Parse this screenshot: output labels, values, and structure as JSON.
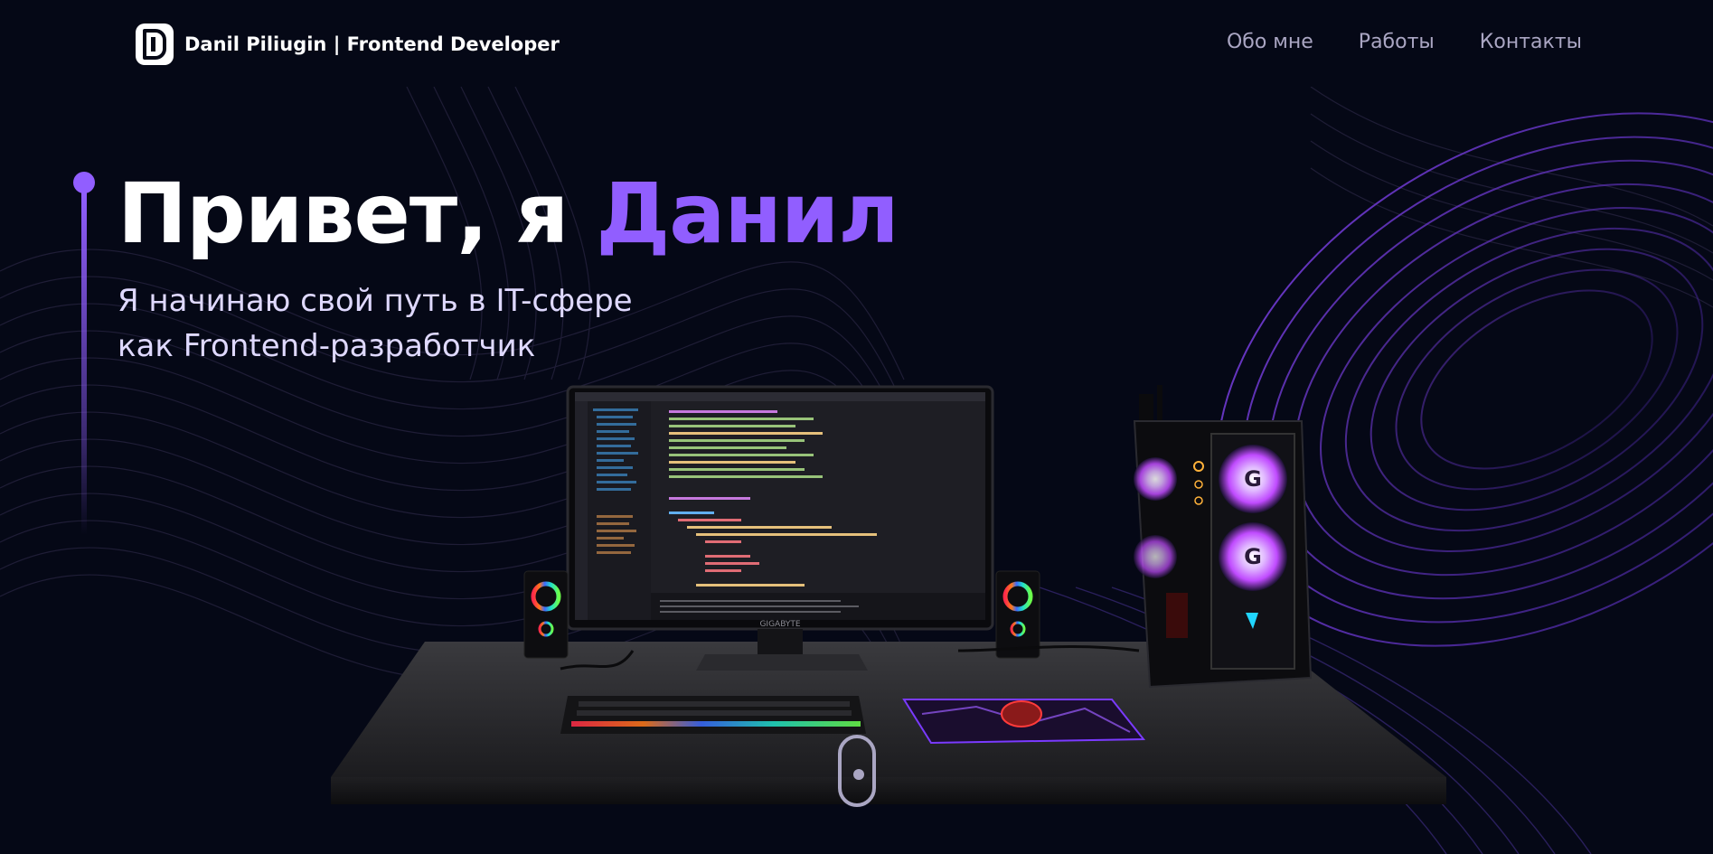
{
  "brand": {
    "name": "Danil Piliugin | Frontend Developer",
    "logo_icon": "logo-icon"
  },
  "nav": {
    "items": [
      {
        "label": "Обо мне"
      },
      {
        "label": "Работы"
      },
      {
        "label": "Контакты"
      }
    ]
  },
  "hero": {
    "title_prefix": "Привет, я ",
    "title_accent": "Данил",
    "subtitle_line1": "Я начинаю свой путь в IT-сфере",
    "subtitle_line2": "как Frontend-разработчик"
  },
  "scene": {
    "monitor_brand": "GIGABYTE"
  },
  "colors": {
    "background": "#050816",
    "accent": "#915eff",
    "nav_text": "#aaa6c3",
    "subtitle": "#dfd9ff"
  },
  "icons": {
    "scroll": "scroll-mouse-icon"
  }
}
